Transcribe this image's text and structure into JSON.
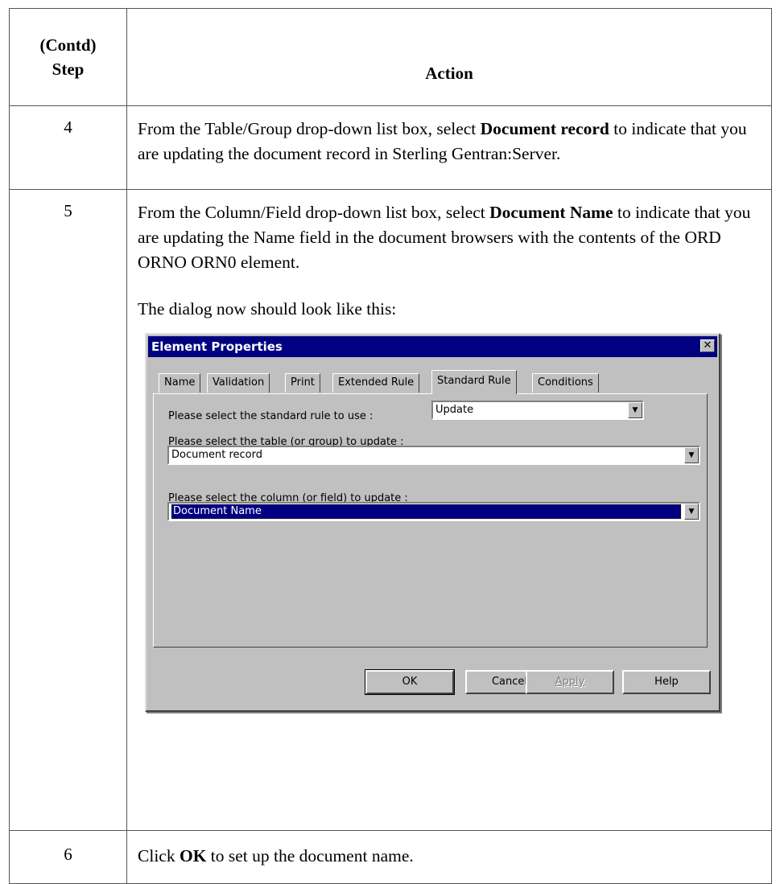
{
  "header": {
    "step_line1": "(Contd)",
    "step_line2": "Step",
    "action": "Action"
  },
  "rows": [
    {
      "step": "4",
      "text_before": "From the Table/Group drop-down list box, select ",
      "bold": "Document record",
      "text_after": " to indicate that you are updating the document record in Sterling Gentran:Server."
    },
    {
      "step": "5",
      "text_before": "From the Column/Field drop-down list box, select ",
      "bold": "Document Name",
      "text_after": " to indicate that you are updating the Name field in the document browsers with the contents of the ORD ORNO ORN0 element.",
      "note": "The dialog now should look like this:"
    },
    {
      "step": "6",
      "text_before": "Click ",
      "bold": "OK",
      "text_after": " to set up the document name."
    }
  ],
  "dialog": {
    "title": "Element Properties",
    "close_glyph": "✕",
    "tabs": [
      "Name",
      "Validation",
      "Print",
      "Extended Rule",
      "Standard Rule",
      "Conditions"
    ],
    "active_tab": "Standard Rule",
    "rule_label": "Please select the standard rule to use :",
    "rule_value": "Update",
    "table_label": "Please select the table (or group) to update :",
    "table_value": "Document record",
    "column_label": "Please select the column (or field) to update :",
    "column_value": "Document Name",
    "buttons": {
      "ok": "OK",
      "cancel": "Cancel",
      "apply": "Apply",
      "help": "Help"
    },
    "arrow_glyph": "▼"
  }
}
